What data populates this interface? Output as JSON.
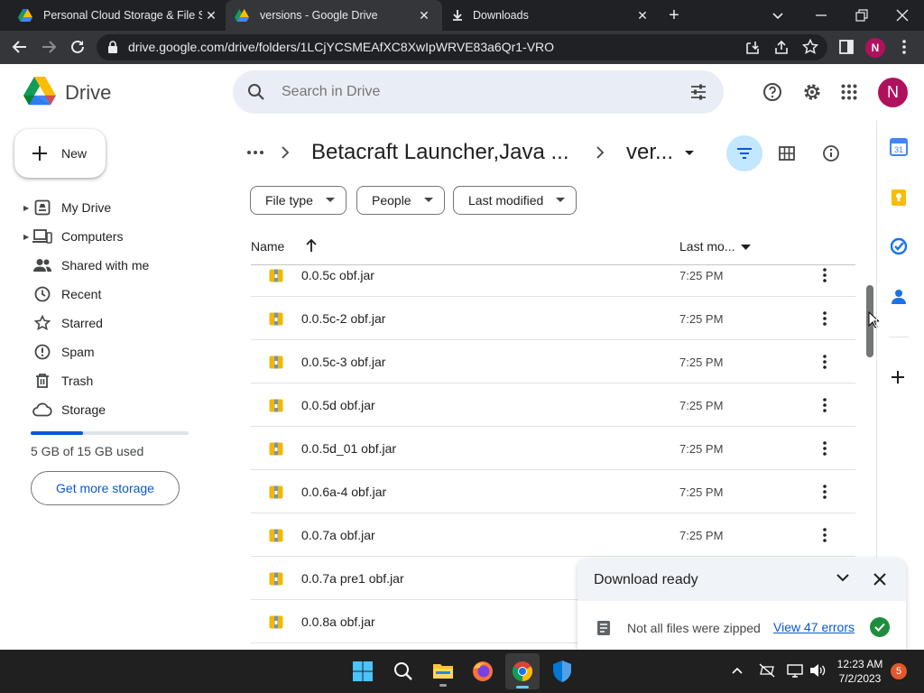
{
  "browser": {
    "tabs": [
      {
        "title": "Personal Cloud Storage & File Sh",
        "icon": "drive-icon",
        "active": false
      },
      {
        "title": "versions - Google Drive",
        "icon": "drive-icon",
        "active": true
      },
      {
        "title": "Downloads",
        "icon": "download-icon",
        "active": false
      }
    ],
    "url": "drive.google.com/drive/folders/1LCjYCSMEAfXC8XwIpWRVE83a6Qr1-VRO",
    "profile_initial": "N"
  },
  "drive": {
    "logo_text": "Drive",
    "search_placeholder": "Search in Drive",
    "new_label": "New",
    "avatar_initial": "N",
    "nav": [
      {
        "label": "My Drive",
        "icon": "my-drive-icon",
        "expandable": true
      },
      {
        "label": "Computers",
        "icon": "computers-icon",
        "expandable": true
      },
      {
        "label": "Shared with me",
        "icon": "shared-icon",
        "expandable": false
      },
      {
        "label": "Recent",
        "icon": "clock-icon",
        "expandable": false
      },
      {
        "label": "Starred",
        "icon": "star-icon",
        "expandable": false
      },
      {
        "label": "Spam",
        "icon": "spam-icon",
        "expandable": false
      },
      {
        "label": "Trash",
        "icon": "trash-icon",
        "expandable": false
      },
      {
        "label": "Storage",
        "icon": "cloud-icon",
        "expandable": false
      }
    ],
    "storage": {
      "text": "5 GB of 15 GB used",
      "used_fraction": 0.33,
      "button": "Get more storage"
    },
    "breadcrumb": {
      "parent": "Betacraft Launcher,Java ...",
      "current": "ver..."
    },
    "filters": [
      "File type",
      "People",
      "Last modified"
    ],
    "columns": {
      "name": "Name",
      "modified": "Last mo..."
    },
    "files": [
      {
        "name": "0.0.5c obf.jar",
        "modified": "7:25 PM"
      },
      {
        "name": "0.0.5c-2 obf.jar",
        "modified": "7:25 PM"
      },
      {
        "name": "0.0.5c-3 obf.jar",
        "modified": "7:25 PM"
      },
      {
        "name": "0.0.5d obf.jar",
        "modified": "7:25 PM"
      },
      {
        "name": "0.0.5d_01 obf.jar",
        "modified": "7:25 PM"
      },
      {
        "name": "0.0.6a-4 obf.jar",
        "modified": "7:25 PM"
      },
      {
        "name": "0.0.7a obf.jar",
        "modified": "7:25 PM"
      },
      {
        "name": "0.0.7a pre1 obf.jar",
        "modified": ""
      },
      {
        "name": "0.0.8a obf.jar",
        "modified": ""
      }
    ],
    "download_panel": {
      "title": "Download ready",
      "message": "Not all files were zipped",
      "link": "View 47 errors"
    }
  },
  "taskbar": {
    "time": "12:23 AM",
    "date": "7/2/2023",
    "notification_count": "5"
  },
  "colors": {
    "accent": "#0b57d0",
    "avatar": "#b0115c",
    "success": "#1e8e3e",
    "chrome_dark": "#202124"
  }
}
